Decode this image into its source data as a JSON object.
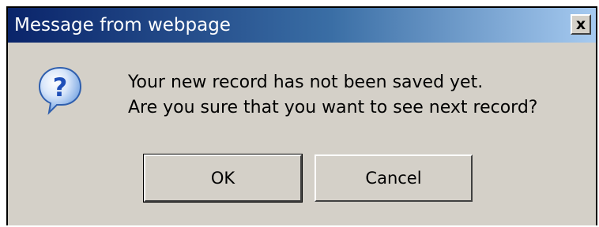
{
  "dialog": {
    "title": "Message from webpage",
    "close_label": "x",
    "icon": "question-icon",
    "message_lines": [
      "Your new record has not been saved yet.",
      "Are you sure that you want to see next record?"
    ],
    "buttons": {
      "ok_label": "OK",
      "cancel_label": "Cancel"
    }
  },
  "colors": {
    "titlebar_start": "#0a246a",
    "titlebar_end": "#a6caf0",
    "face": "#d4d0c8",
    "icon_blue": "#2f6fd1"
  }
}
